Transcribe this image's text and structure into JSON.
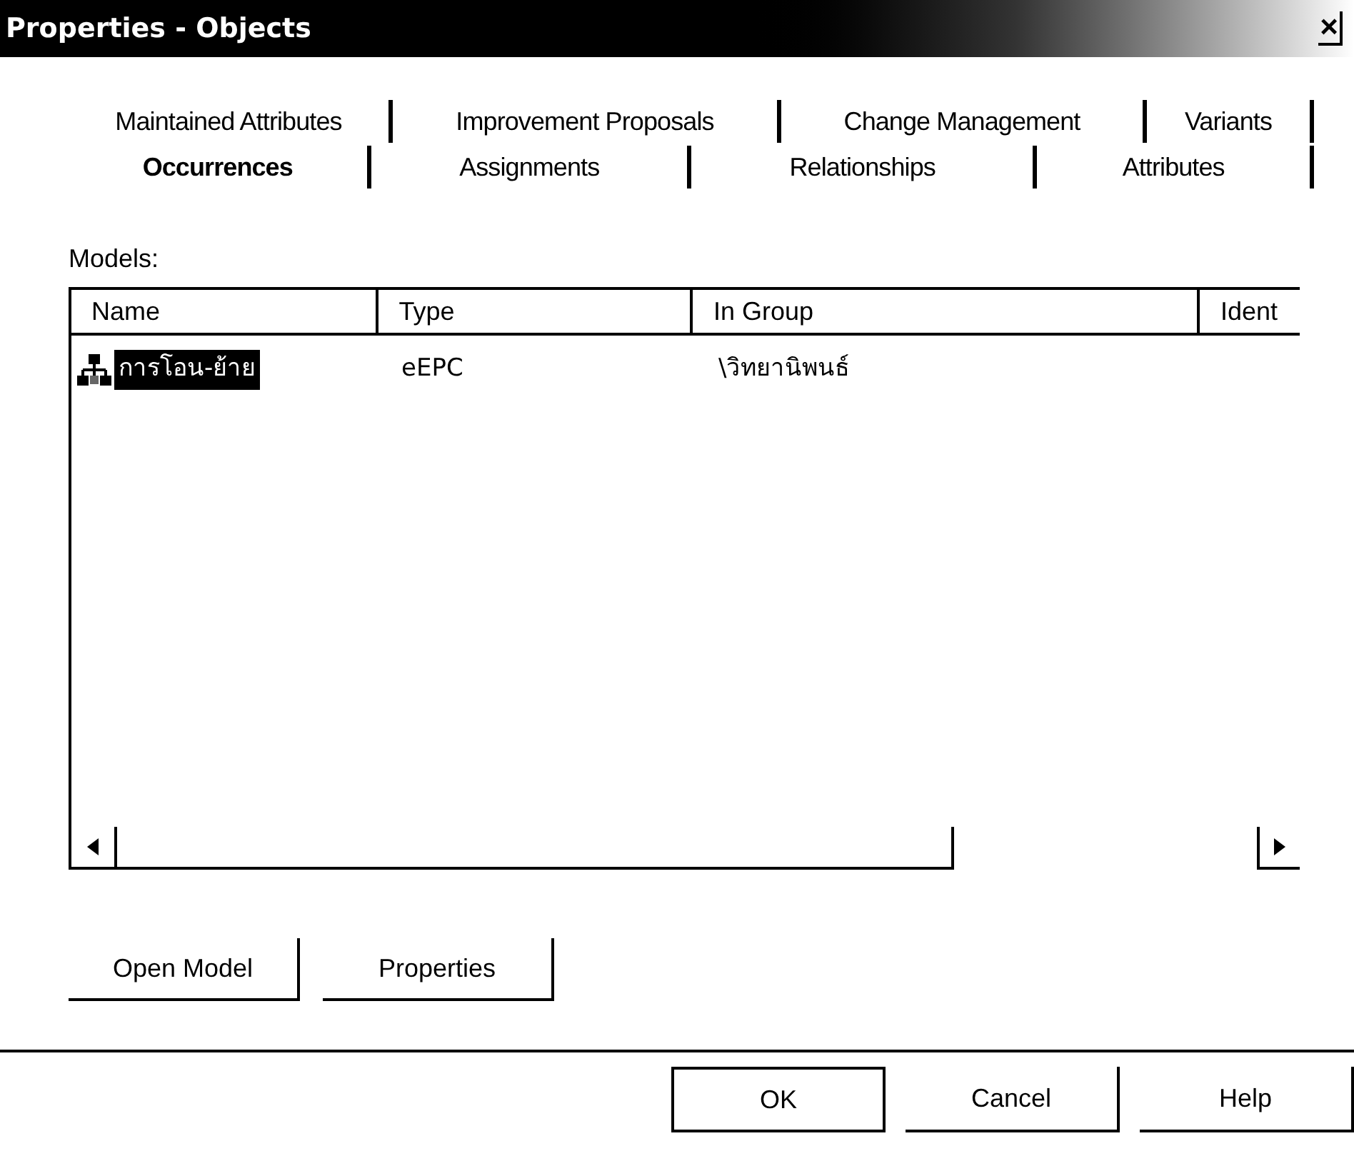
{
  "window": {
    "title": "Properties - Objects",
    "close": "×"
  },
  "tab_rows": [
    [
      {
        "label": "Maintained Attributes",
        "selected": false
      },
      {
        "label": "Improvement Proposals",
        "selected": false
      },
      {
        "label": "Change Management",
        "selected": false
      },
      {
        "label": "Variants",
        "selected": false
      }
    ],
    [
      {
        "label": "Occurrences",
        "selected": true
      },
      {
        "label": "Assignments",
        "selected": false
      },
      {
        "label": "Relationships",
        "selected": false
      },
      {
        "label": "Attributes",
        "selected": false
      }
    ]
  ],
  "models": {
    "label": "Models:",
    "columns": [
      "Name",
      "Type",
      "In Group",
      "Ident"
    ],
    "rows": [
      {
        "cells": [
          "การโอน-ย้าย",
          "eEPC",
          "\\วิทยานิพนธ์"
        ],
        "selected": true
      }
    ]
  },
  "buttons": [
    "Open Model",
    "Properties"
  ],
  "dialog_buttons": [
    {
      "label": "OK",
      "default": true
    },
    {
      "label": "Cancel",
      "default": false
    },
    {
      "label": "Help",
      "default": false
    }
  ]
}
